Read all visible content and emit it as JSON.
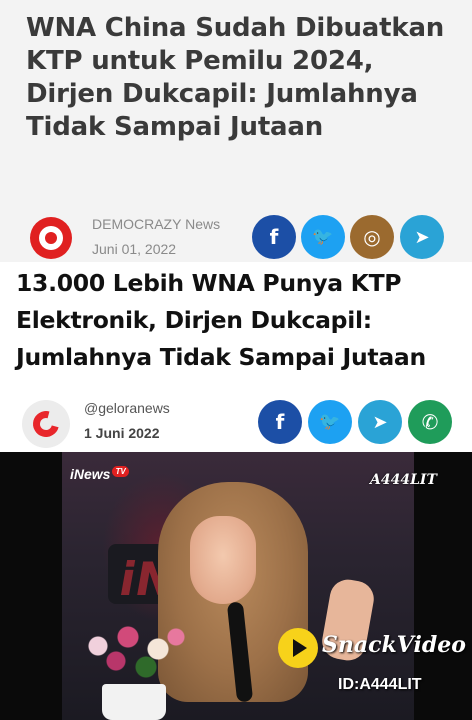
{
  "article1": {
    "headline": "WNA China Sudah Dibuatkan KTP untuk Pemilu 2024, Dirjen Dukcapil: Jumlahnya Tidak Sampai Jutaan",
    "source_name": "DEMOCRAZY News",
    "date": "Juni 01, 2022",
    "share_icons": [
      "facebook-icon",
      "twitter-icon",
      "instagram-icon",
      "telegram-icon"
    ]
  },
  "article2": {
    "headline": "13.000 Lebih WNA Punya KTP Elektronik, Dirjen Dukcapil: Jumlahnya Tidak Sampai Jutaan",
    "source_name": "@geloranews",
    "date": "1 Juni 2022",
    "share_icons": [
      "facebook-icon",
      "twitter-icon",
      "telegram-icon",
      "whatsapp-icon"
    ]
  },
  "video": {
    "channel_badge": "iNews",
    "channel_badge_tv": "TV",
    "background_text": "iNews",
    "watermark": "A444LIT",
    "snack_brand": "SnackVideo",
    "snack_id": "ID:A444LIT"
  },
  "icons": {
    "facebook": "f",
    "twitter": "🐦",
    "instagram": "◎",
    "telegram": "➤",
    "whatsapp": "✆"
  },
  "colors": {
    "facebook": "#1c4fa6",
    "twitter": "#1da1f2",
    "instagram": "#9b6a2f",
    "telegram": "#2aa3d6",
    "whatsapp": "#1f9c5a",
    "source1_logo": "#e02020",
    "source2_logo": "#e8262b"
  }
}
